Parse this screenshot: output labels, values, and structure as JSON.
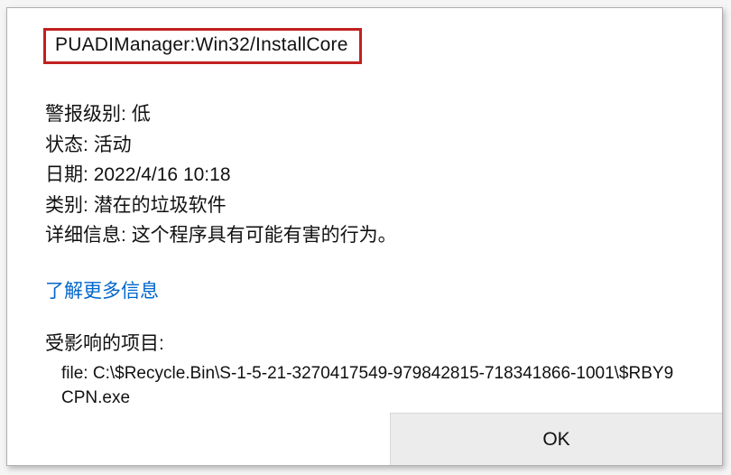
{
  "threat": {
    "name": "PUADIManager:Win32/InstallCore"
  },
  "details": {
    "alert_level_label": "警报级别:",
    "alert_level_value": "低",
    "status_label": "状态:",
    "status_value": "活动",
    "date_label": "日期:",
    "date_value": "2022/4/16 10:18",
    "category_label": "类别:",
    "category_value": "潜在的垃圾软件",
    "description_label": "详细信息:",
    "description_value": "这个程序具有可能有害的行为。"
  },
  "learn_more": {
    "text": "了解更多信息"
  },
  "affected": {
    "label": "受影响的项目:",
    "path": "file: C:\\$Recycle.Bin\\S-1-5-21-3270417549-979842815-718341866-1001\\$RBY9CPN.exe"
  },
  "buttons": {
    "ok_label": "OK"
  }
}
